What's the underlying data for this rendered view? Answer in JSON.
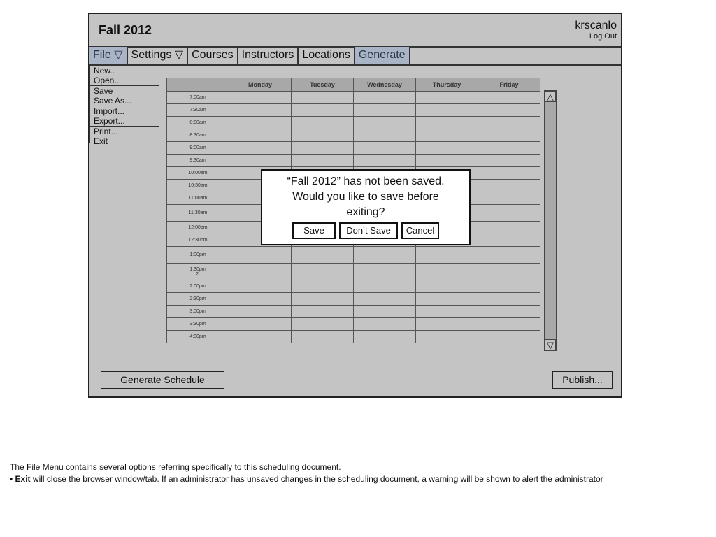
{
  "header": {
    "title": "Fall 2012",
    "username": "krscanlo",
    "logout_label": "Log Out"
  },
  "menubar": {
    "file": "File ▽",
    "settings": "Settings ▽",
    "courses": "Courses",
    "instructors": "Instructors",
    "locations": "Locations",
    "generate": "Generate"
  },
  "file_menu": {
    "items": [
      "New..",
      "Open...",
      "Save",
      "Save As...",
      "Import...",
      "Export...",
      "Print...",
      "Exit"
    ]
  },
  "schedule": {
    "days": [
      "Monday",
      "Tuesday",
      "Wednesday",
      "Thursday",
      "Friday"
    ],
    "times": [
      "7:00am",
      "7:30am",
      "8:00am",
      "8:30am",
      "9:00am",
      "9:30am",
      "10:00am",
      "10:30am",
      "11:00am",
      "11:30am",
      "12:00pm",
      "12:30pm",
      "1:00pm",
      "1:30pm",
      "2:00pm",
      "2:30pm",
      "3:00pm",
      "3:30pm",
      "4:00pm"
    ],
    "time_130_extra": "2:"
  },
  "scrollbar": {
    "up_icon": "triangle-up-icon",
    "down_icon": "triangle-down-icon",
    "up_glyph": "△",
    "down_glyph": "▽"
  },
  "buttons": {
    "generate_schedule": "Generate Schedule",
    "publish": "Publish..."
  },
  "dialog": {
    "line1": "“Fall 2012” has not been saved.",
    "line2": "Would you like to save before",
    "line3": "exiting?",
    "save": "Save",
    "dont_save": "Don’t Save",
    "cancel": "Cancel"
  },
  "notes": {
    "line1": "The File Menu contains several options referring specifically to this scheduling document.",
    "bullet": "•",
    "term": "Exit",
    "desc": "will close the browser window/tab. If an administrator has unsaved changes in the scheduling document, a warning will be shown to alert the administrator"
  },
  "colors": {
    "background": "#c4c4c4",
    "active_menu": "#a9b4c6",
    "header_row": "#a8a8a8"
  }
}
